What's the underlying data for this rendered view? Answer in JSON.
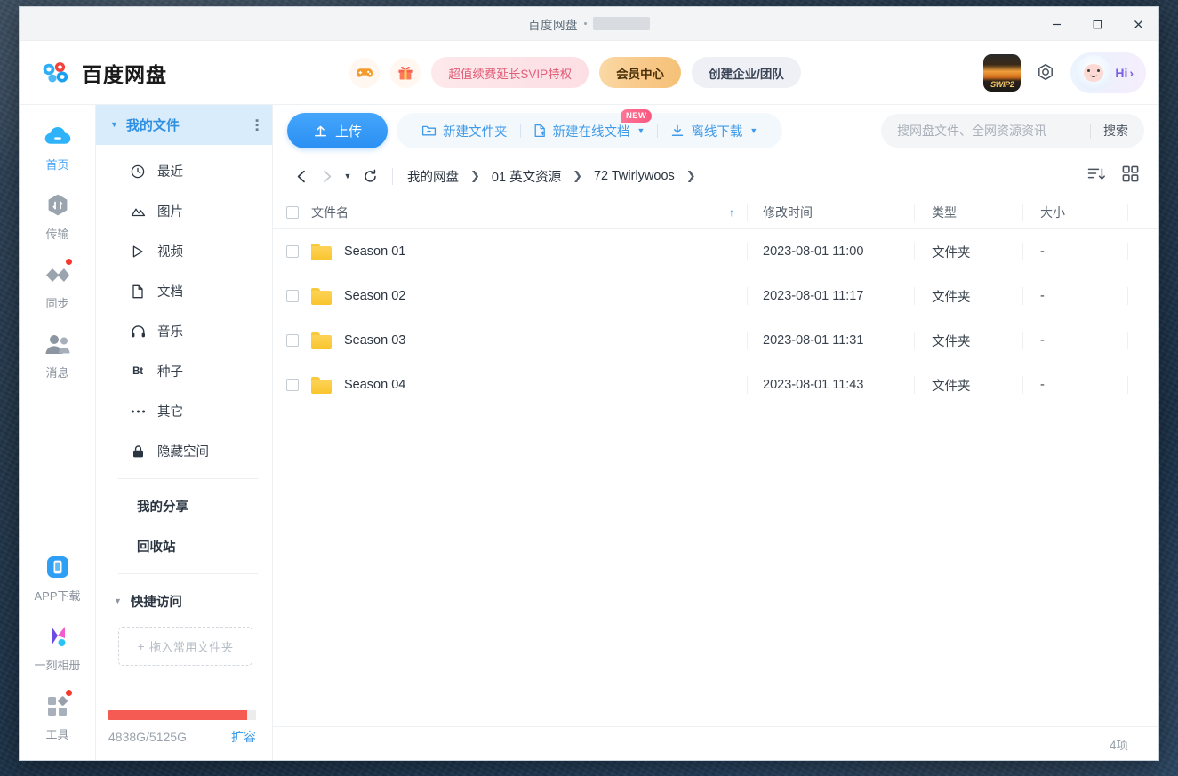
{
  "window": {
    "title": "百度网盘",
    "title_separator": "·",
    "minimize_label": "最小化",
    "maximize_label": "最大化",
    "close_label": "关闭"
  },
  "header": {
    "brand": "百度网盘",
    "game_icon": "gamepad-icon",
    "gift_icon": "gift-icon",
    "svip_promo": "超值续费延长SVIP特权",
    "vip_center": "会员中心",
    "create_team": "创建企业/团队",
    "swip_badge": "SWIP2",
    "settings_icon": "gear-icon",
    "greeting": "Hi",
    "greeting_arrow": "›"
  },
  "rail": {
    "items": [
      {
        "label": "首页",
        "icon": "cloud-home-icon",
        "active": true,
        "badge": false
      },
      {
        "label": "传输",
        "icon": "transfer-icon",
        "active": false,
        "badge": false
      },
      {
        "label": "同步",
        "icon": "sync-icon",
        "active": false,
        "badge": true
      },
      {
        "label": "消息",
        "icon": "message-users-icon",
        "active": false,
        "badge": false
      }
    ],
    "bottom_items": [
      {
        "label": "APP下载",
        "icon": "phone-app-icon",
        "badge": false
      },
      {
        "label": "一刻相册",
        "icon": "photo-album-icon",
        "badge": false
      },
      {
        "label": "工具",
        "icon": "tools-grid-icon",
        "badge": true
      }
    ]
  },
  "tree": {
    "header_label": "我的文件",
    "header_caret": "▼",
    "header_menu_icon": "kebab-menu-icon",
    "items": [
      {
        "label": "最近",
        "icon": "clock-icon"
      },
      {
        "label": "图片",
        "icon": "image-icon"
      },
      {
        "label": "视频",
        "icon": "video-play-icon"
      },
      {
        "label": "文档",
        "icon": "document-icon"
      },
      {
        "label": "音乐",
        "icon": "headphones-icon"
      },
      {
        "label": "种子",
        "icon": "bt-icon"
      },
      {
        "label": "其它",
        "icon": "ellipsis-icon"
      },
      {
        "label": "隐藏空间",
        "icon": "lock-icon"
      }
    ],
    "plain_items": [
      {
        "label": "我的分享"
      },
      {
        "label": "回收站"
      }
    ],
    "quick_access": {
      "label": "快捷访问",
      "caret": "▼",
      "dropzone_plus": "+",
      "dropzone_label": "拖入常用文件夹"
    },
    "quota": {
      "used": "4838G",
      "total": "5125G",
      "text": "4838G/5125G",
      "percent": 94,
      "expand_label": "扩容",
      "bar_color": "#f55b52"
    }
  },
  "toolbar": {
    "upload_label": "上传",
    "upload_icon": "upload-icon",
    "new_folder_label": "新建文件夹",
    "new_folder_icon": "folder-plus-icon",
    "new_doc_label": "新建在线文档",
    "new_doc_icon": "doc-plus-icon",
    "new_doc_badge": "NEW",
    "offline_dl_label": "离线下载",
    "offline_dl_icon": "download-icon",
    "caret": "▼"
  },
  "search": {
    "placeholder": "搜网盘文件、全网资源资讯",
    "value": "",
    "button_label": "搜索"
  },
  "breadcrumb": {
    "back_icon": "chevron-left-icon",
    "forward_icon": "chevron-right-icon",
    "history_caret": "▼",
    "refresh_icon": "refresh-icon",
    "separator": "❯",
    "path": [
      "我的网盘",
      "01 英文资源",
      "72 Twirlywoos"
    ],
    "trailing_separator": "❯"
  },
  "view_controls": {
    "sort_icon": "sort-list-icon",
    "grid_icon": "grid-view-icon"
  },
  "file_table": {
    "columns": [
      "文件名",
      "修改时间",
      "类型",
      "大小"
    ],
    "sort_indicator": "↑",
    "sorted_column": "文件名",
    "rows": [
      {
        "name": "Season 01",
        "modified": "2023-08-01 11:00",
        "type": "文件夹",
        "size": "-",
        "icon": "folder-icon",
        "checked": false
      },
      {
        "name": "Season 02",
        "modified": "2023-08-01 11:17",
        "type": "文件夹",
        "size": "-",
        "icon": "folder-icon",
        "checked": false
      },
      {
        "name": "Season 03",
        "modified": "2023-08-01 11:31",
        "type": "文件夹",
        "size": "-",
        "icon": "folder-icon",
        "checked": false
      },
      {
        "name": "Season 04",
        "modified": "2023-08-01 11:43",
        "type": "文件夹",
        "size": "-",
        "icon": "folder-icon",
        "checked": false
      }
    ]
  },
  "status_bar": {
    "item_count": "4项"
  },
  "colors": {
    "accent_blue": "#3f9ae8",
    "upload_blue": "#2a8ff3",
    "tree_header_bg": "#d9ecfb",
    "quota_red": "#f55b52",
    "folder_yellow": "#f9c52e",
    "badge_red": "#f5392f",
    "new_badge_pink": "#f9577e",
    "vip_gold": "#f6c177"
  }
}
